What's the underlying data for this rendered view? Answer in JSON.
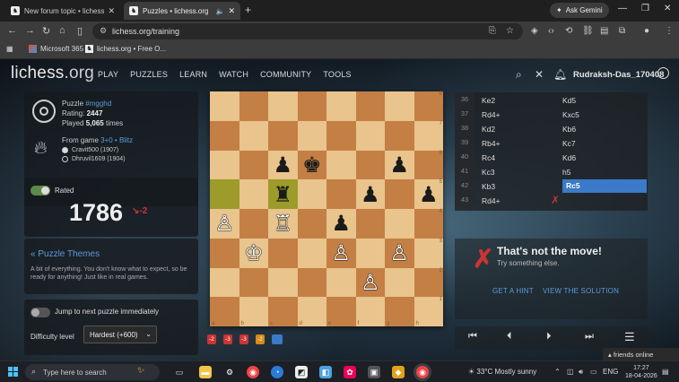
{
  "browser": {
    "tabs": [
      {
        "title": "New forum topic • lichess.org"
      },
      {
        "title": "Puzzles • lichess.org"
      }
    ],
    "gemini_label": "Ask Gemini",
    "url": "lichess.org/training",
    "bookmarks": [
      {
        "label": "Microsoft 365"
      },
      {
        "label": "lichess.org • Free O..."
      }
    ]
  },
  "site": {
    "logo": "lichess",
    "logo_tld": ".org",
    "nav": [
      "PLAY",
      "PUZZLES",
      "LEARN",
      "WATCH",
      "COMMUNITY",
      "TOOLS"
    ],
    "username": "Rudraksh-Das_170408"
  },
  "puzzle": {
    "label": "Puzzle",
    "id": "#mgghd",
    "rating_label": "Rating:",
    "rating": "2447",
    "played_prefix": "Played",
    "played_count": "5,065",
    "played_suffix": "times",
    "from_game_label": "From game",
    "game_type": "3+0 • Blitz",
    "players": [
      {
        "name": "Cravit500 (1907)",
        "color": "white"
      },
      {
        "name": "Dhruvil1609 (1904)",
        "color": "black"
      }
    ]
  },
  "user_rating": {
    "rated_label": "Rated",
    "value": "1786",
    "delta": "↘-2"
  },
  "theme": {
    "title": "« Puzzle Themes",
    "description": "A bit of everything. You don't know what to expect, so be ready for anything! Just like in real games."
  },
  "settings": {
    "jump_label": "Jump to next puzzle immediately",
    "difficulty_label": "Difficulty level",
    "difficulty_value": "Hardest (+600)"
  },
  "board": {
    "files": [
      "a",
      "b",
      "c",
      "d",
      "e",
      "f",
      "g",
      "h"
    ],
    "ranks": [
      "8",
      "7",
      "6",
      "5",
      "4",
      "3",
      "2",
      "1"
    ],
    "pieces": [
      {
        "sq": "c6",
        "p": "♟",
        "c": "b"
      },
      {
        "sq": "d6",
        "p": "♚",
        "c": "b"
      },
      {
        "sq": "g6",
        "p": "♟",
        "c": "b"
      },
      {
        "sq": "c5",
        "p": "♜",
        "c": "b"
      },
      {
        "sq": "f5",
        "p": "♟",
        "c": "b"
      },
      {
        "sq": "h5",
        "p": "♟",
        "c": "b"
      },
      {
        "sq": "a4",
        "p": "♙",
        "c": "w"
      },
      {
        "sq": "c4",
        "p": "♖",
        "c": "w"
      },
      {
        "sq": "e4",
        "p": "♟",
        "c": "b"
      },
      {
        "sq": "b3",
        "p": "♔",
        "c": "w"
      },
      {
        "sq": "e3",
        "p": "♙",
        "c": "w"
      },
      {
        "sq": "g3",
        "p": "♙",
        "c": "w"
      },
      {
        "sq": "f2",
        "p": "♙",
        "c": "w"
      }
    ],
    "highlighted": [
      "a5",
      "c5"
    ]
  },
  "streak": [
    "-2",
    "-3",
    "-3",
    "-2",
    ""
  ],
  "moves": [
    {
      "n": "36",
      "w": "Ke2",
      "b": "Kd5"
    },
    {
      "n": "37",
      "w": "Rd4+",
      "b": "Kxc5"
    },
    {
      "n": "38",
      "w": "Kd2",
      "b": "Kb6"
    },
    {
      "n": "39",
      "w": "Rb4+",
      "b": "Kc7"
    },
    {
      "n": "40",
      "w": "Rc4",
      "b": "Kd6"
    },
    {
      "n": "41",
      "w": "Kc3",
      "b": "h5"
    },
    {
      "n": "42",
      "w": "Kb3",
      "b": "Rc5"
    },
    {
      "n": "43",
      "w": "Rd4+",
      "b": ""
    }
  ],
  "feedback": {
    "title": "That's not the move!",
    "subtitle": "Try something else.",
    "hint": "GET A HINT",
    "solution": "VIEW THE SOLUTION"
  },
  "friends_label": "friends online",
  "taskbar": {
    "search_placeholder": "Type here to search",
    "weather": "33°C  Mostly sunny",
    "lang": "ENG",
    "time": "17:27",
    "date": "18-04-2026"
  },
  "colors": {
    "accent_link": "#5d9adb",
    "error_red": "#cc3333",
    "move_selected": "#3a7ac8"
  }
}
